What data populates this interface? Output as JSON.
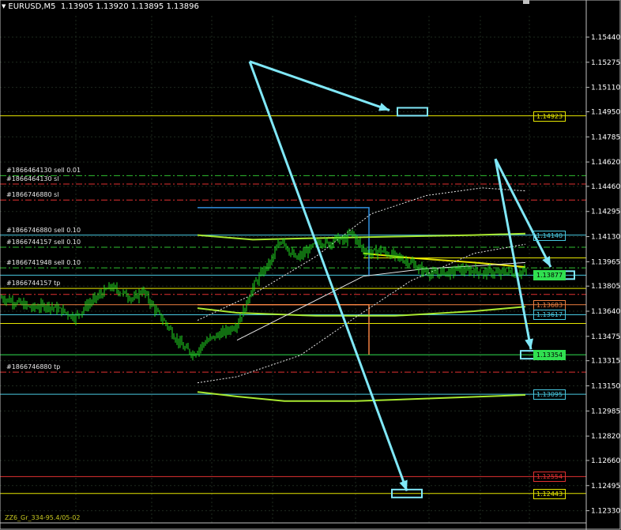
{
  "header": {
    "symbol": "EURUSD,M5",
    "ohlc": "1.13905 1.13920 1.13895 1.13896"
  },
  "footer": {
    "text": "ZZ6_Gr_334-95.4/05-02"
  },
  "colors": {
    "background": "#000000",
    "grid": "#1e2a1e",
    "candle": "#22dd22",
    "boxes": "#80e8f8",
    "arrows": "#80e8f8",
    "ma": "#a8e830"
  },
  "chart_data": {
    "type": "candlestick",
    "symbol": "EURUSD",
    "timeframe": "M5",
    "ylim": [
      1.1225,
      1.1558
    ],
    "y_ticks": [
      "1.15440",
      "1.15275",
      "1.15110",
      "1.14950",
      "1.14785",
      "1.14620",
      "1.14460",
      "1.14295",
      "1.14130",
      "1.13965",
      "1.13805",
      "1.13640",
      "1.13475",
      "1.13315",
      "1.13150",
      "1.12985",
      "1.12820",
      "1.12660",
      "1.12495",
      "1.12330"
    ],
    "grid": true,
    "current_price": "1.13877",
    "price_path": [
      [
        0,
        1.1373
      ],
      [
        20,
        1.137
      ],
      [
        40,
        1.1366
      ],
      [
        60,
        1.1368
      ],
      [
        80,
        1.1364
      ],
      [
        95,
        1.136
      ],
      [
        110,
        1.1368
      ],
      [
        125,
        1.1374
      ],
      [
        140,
        1.138
      ],
      [
        155,
        1.1376
      ],
      [
        170,
        1.1372
      ],
      [
        180,
        1.1378
      ],
      [
        190,
        1.137
      ],
      [
        200,
        1.1362
      ],
      [
        210,
        1.1356
      ],
      [
        220,
        1.1348
      ],
      [
        232,
        1.134
      ],
      [
        245,
        1.1336
      ],
      [
        260,
        1.1344
      ],
      [
        275,
        1.1348
      ],
      [
        290,
        1.1352
      ],
      [
        300,
        1.1356
      ],
      [
        310,
        1.1366
      ],
      [
        318,
        1.1378
      ],
      [
        325,
        1.1384
      ],
      [
        335,
        1.1392
      ],
      [
        342,
        1.1396
      ],
      [
        350,
        1.1405
      ],
      [
        358,
        1.1412
      ],
      [
        365,
        1.1404
      ],
      [
        375,
        1.1398
      ],
      [
        385,
        1.1402
      ],
      [
        395,
        1.1406
      ],
      [
        405,
        1.141
      ],
      [
        415,
        1.1408
      ],
      [
        425,
        1.1412
      ],
      [
        435,
        1.141
      ],
      [
        445,
        1.1416
      ],
      [
        452,
        1.141
      ],
      [
        460,
        1.1404
      ],
      [
        470,
        1.1402
      ],
      [
        480,
        1.1404
      ],
      [
        490,
        1.1402
      ],
      [
        500,
        1.14
      ],
      [
        510,
        1.1398
      ],
      [
        520,
        1.1396
      ],
      [
        530,
        1.1392
      ],
      [
        540,
        1.139
      ],
      [
        550,
        1.1388
      ],
      [
        560,
        1.139
      ],
      [
        570,
        1.1389
      ],
      [
        580,
        1.1392
      ],
      [
        590,
        1.139
      ],
      [
        600,
        1.1391
      ],
      [
        610,
        1.1389
      ],
      [
        620,
        1.139
      ],
      [
        630,
        1.1388
      ],
      [
        640,
        1.139
      ],
      [
        650,
        1.1389
      ],
      [
        660,
        1.139
      ],
      [
        668,
        1.139
      ]
    ],
    "levels": [
      {
        "price": 1.14923,
        "color": "#e6e600",
        "style": "solid",
        "label": "1.14923",
        "label_color": "#e6e600",
        "x_start": 0
      },
      {
        "price": 1.1453,
        "color": "#30c030",
        "style": "dashdot",
        "text": "#1866464130 sell 0.01",
        "x_start": 0
      },
      {
        "price": 1.14475,
        "color": "#e03030",
        "style": "dashdot",
        "text": "#1866464130 sl",
        "x_start": 0
      },
      {
        "price": 1.1437,
        "color": "#e03030",
        "style": "dashdot",
        "text": "#1866746880 sl",
        "x_start": 0
      },
      {
        "price": 1.1414,
        "color": "#48c8e0",
        "style": "solid",
        "label": "1.14140",
        "label_color": "#48c8e0",
        "x_start": 0,
        "text": "#1866746880 sell 0.10"
      },
      {
        "price": 1.1406,
        "color": "#30c030",
        "style": "dashdot",
        "text": "#1866744157 sell 0.10",
        "x_start": 0
      },
      {
        "price": 1.1399,
        "color": "#e6e600",
        "style": "solid",
        "x_start": 460
      },
      {
        "price": 1.13925,
        "color": "#30c030",
        "style": "dashdot",
        "text": "#1866741948 sell 0.10",
        "x_start": 0
      },
      {
        "price": 1.13877,
        "color": "#48c8e0",
        "style": "solid",
        "label": "1.13877",
        "label_color": "#000000",
        "label_bg": "#30e050",
        "x_start": 0
      },
      {
        "price": 1.1379,
        "color": "#e6e600",
        "style": "solid",
        "text": "#1866744157 tp",
        "x_start": 0
      },
      {
        "price": 1.1375,
        "color": "#e03030",
        "style": "dashdot",
        "x_start": 0
      },
      {
        "price": 1.13683,
        "color": "#f08040",
        "style": "solid",
        "label": "1.13683",
        "label_color": "#f08040",
        "x_start": 0
      },
      {
        "price": 1.13617,
        "color": "#48c8e0",
        "style": "solid",
        "label": "1.13617",
        "label_color": "#48c8e0",
        "x_start": 0
      },
      {
        "price": 1.1356,
        "color": "#e6e600",
        "style": "solid",
        "x_start": 0
      },
      {
        "price": 1.13354,
        "color": "#30e050",
        "style": "solid",
        "label": "1.13354",
        "label_color": "#000000",
        "label_bg": "#30e050",
        "x_start": 0
      },
      {
        "price": 1.1324,
        "color": "#e03030",
        "style": "dashdot",
        "text": "#1866746880 tp",
        "x_start": 0
      },
      {
        "price": 1.13095,
        "color": "#48c8e0",
        "style": "solid",
        "label": "1.13095",
        "label_color": "#48c8e0",
        "x_start": 0
      },
      {
        "price": 1.12554,
        "color": "#e03030",
        "style": "solid",
        "label": "1.12554",
        "label_color": "#e03030",
        "x_start": 0
      },
      {
        "price": 1.12443,
        "color": "#e6e600",
        "style": "solid",
        "label": "1.12443",
        "label_color": "#e6e600",
        "x_start": 0
      }
    ],
    "arrows": [
      {
        "from": [
          316,
          1.1528
        ],
        "to": [
          493,
          1.1496
        ]
      },
      {
        "from": [
          316,
          1.1528
        ],
        "to": [
          515,
          1.1246
        ]
      },
      {
        "from": [
          627,
          1.1464
        ],
        "to": [
          697,
          1.1393
        ]
      },
      {
        "from": [
          627,
          1.1464
        ],
        "to": [
          672,
          1.1339
        ]
      }
    ],
    "target_boxes": [
      {
        "x": 504,
        "price": 1.1495
      },
      {
        "x": 690,
        "price": 1.13877
      },
      {
        "x": 660,
        "price": 1.13354
      },
      {
        "x": 497,
        "price": 1.12443
      }
    ]
  }
}
